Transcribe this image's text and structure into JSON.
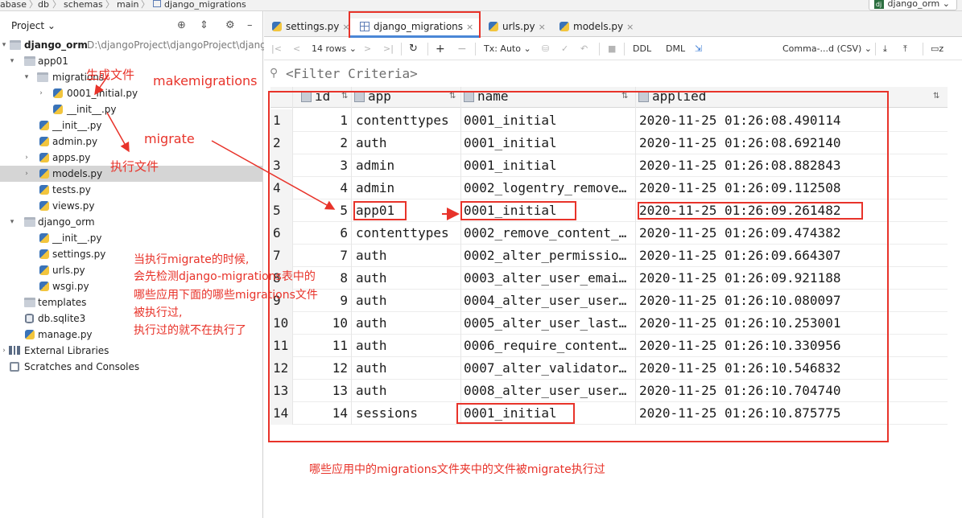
{
  "navbar": {
    "crumbs": [
      "abase",
      "db",
      "schemas",
      "main",
      "django_migrations"
    ],
    "run_config": "django_orm"
  },
  "project": {
    "title": "Project",
    "tree": [
      {
        "label": "django_orm",
        "path": "D:\\djangoProject\\djangoProject\\django"
      },
      {
        "label": "app01"
      },
      {
        "label": "migrations"
      },
      {
        "label": "0001_initial.py"
      },
      {
        "label": "__init__.py"
      },
      {
        "label": "__init__.py"
      },
      {
        "label": "admin.py"
      },
      {
        "label": "apps.py"
      },
      {
        "label": "models.py"
      },
      {
        "label": "tests.py"
      },
      {
        "label": "views.py"
      },
      {
        "label": "django_orm"
      },
      {
        "label": "__init__.py"
      },
      {
        "label": "settings.py"
      },
      {
        "label": "urls.py"
      },
      {
        "label": "wsgi.py"
      },
      {
        "label": "templates"
      },
      {
        "label": "db.sqlite3"
      },
      {
        "label": "manage.py"
      },
      {
        "label": "External Libraries"
      },
      {
        "label": "Scratches and Consoles"
      }
    ]
  },
  "tabs": [
    {
      "label": "settings.py",
      "close": "×"
    },
    {
      "label": "django_migrations",
      "close": "×"
    },
    {
      "label": "urls.py",
      "close": "×"
    },
    {
      "label": "models.py",
      "close": "×"
    }
  ],
  "toolbar": {
    "rows": "14 rows",
    "tx": "Tx: Auto",
    "ddl": "DDL",
    "dml": "DML",
    "format": "Comma-...d (CSV)"
  },
  "filter": {
    "placeholder": "<Filter Criteria>"
  },
  "table": {
    "columns": [
      "id",
      "app",
      "name",
      "applied"
    ],
    "rows": [
      [
        "1",
        "1",
        "contenttypes",
        "0001_initial",
        "2020-11-25 01:26:08.490114"
      ],
      [
        "2",
        "2",
        "auth",
        "0001_initial",
        "2020-11-25 01:26:08.692140"
      ],
      [
        "3",
        "3",
        "admin",
        "0001_initial",
        "2020-11-25 01:26:08.882843"
      ],
      [
        "4",
        "4",
        "admin",
        "0002_logentry_remove…",
        "2020-11-25 01:26:09.112508"
      ],
      [
        "5",
        "5",
        "app01",
        "0001_initial",
        "2020-11-25 01:26:09.261482"
      ],
      [
        "6",
        "6",
        "contenttypes",
        "0002_remove_content_…",
        "2020-11-25 01:26:09.474382"
      ],
      [
        "7",
        "7",
        "auth",
        "0002_alter_permissio…",
        "2020-11-25 01:26:09.664307"
      ],
      [
        "8",
        "8",
        "auth",
        "0003_alter_user_emai…",
        "2020-11-25 01:26:09.921188"
      ],
      [
        "9",
        "9",
        "auth",
        "0004_alter_user_user…",
        "2020-11-25 01:26:10.080097"
      ],
      [
        "10",
        "10",
        "auth",
        "0005_alter_user_last…",
        "2020-11-25 01:26:10.253001"
      ],
      [
        "11",
        "11",
        "auth",
        "0006_require_content…",
        "2020-11-25 01:26:10.330956"
      ],
      [
        "12",
        "12",
        "auth",
        "0007_alter_validator…",
        "2020-11-25 01:26:10.546832"
      ],
      [
        "13",
        "13",
        "auth",
        "0008_alter_user_user…",
        "2020-11-25 01:26:10.704740"
      ],
      [
        "14",
        "14",
        "sessions",
        "0001_initial",
        "2020-11-25 01:26:10.875775"
      ]
    ]
  },
  "annotations": {
    "generate_file": "生成文件",
    "makemigrations": "makemigrations",
    "migrate": "migrate",
    "execute_file": "执行文件",
    "note_lines": [
      "当执行migrate的时候,",
      "会先检测django-migrations表中的",
      "哪些应用下面的哪些migrations文件",
      "被执行过,",
      "执行过的就不在执行了"
    ],
    "bottom_note": "哪些应用中的migrations文件夹中的文件被migrate执行过",
    "color": "#e8332a"
  }
}
